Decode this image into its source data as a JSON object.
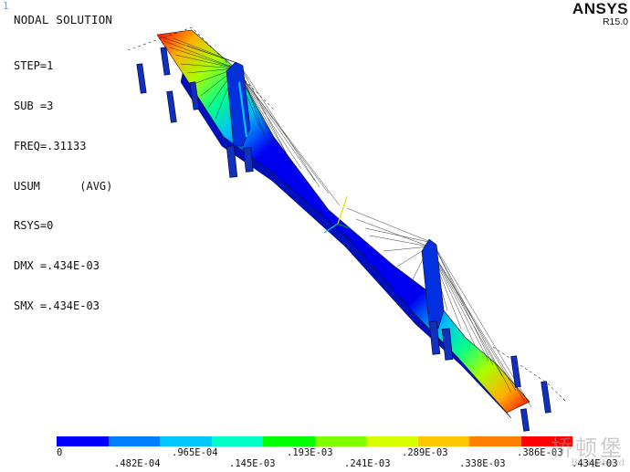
{
  "window": {
    "number": "1"
  },
  "plot": {
    "title": "NODAL SOLUTION",
    "info_lines": [
      "STEP=1",
      "SUB =3",
      "FREQ=.31133",
      "USUM      (AVG)",
      "RSYS=0",
      "DMX =.434E-03",
      "SMX =.434E-03"
    ]
  },
  "brand": {
    "name": "ANSYS",
    "version": "R15.0"
  },
  "legend": {
    "colors": [
      "#0000ff",
      "#0080ff",
      "#00c8ff",
      "#00ffc8",
      "#00ff00",
      "#80ff00",
      "#d8ff00",
      "#ffc800",
      "#ff8000",
      "#ff0000"
    ],
    "labels_top": [
      "0",
      ".965E-04",
      ".193E-03",
      ".289E-03",
      ".386E-03"
    ],
    "labels_bottom": [
      ".482E-04",
      ".145E-03",
      ".241E-03",
      ".338E-03",
      ".434E-03"
    ]
  },
  "watermark": {
    "text": "桥顿堡",
    "subtext": "Bridgehead"
  }
}
